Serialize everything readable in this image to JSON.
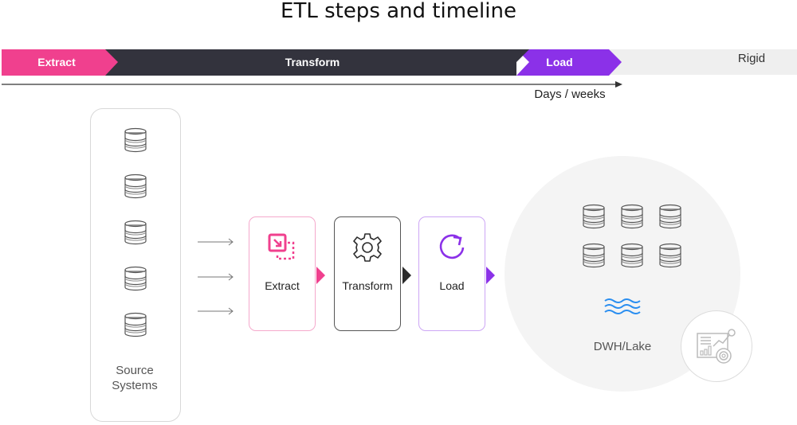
{
  "title": "ETL steps and timeline",
  "timeline": {
    "segments": [
      {
        "label": "Extract",
        "color": "#f0408e"
      },
      {
        "label": "Transform",
        "color": "#33333d"
      },
      {
        "label": "Load",
        "color": "#8b31e8"
      }
    ],
    "remainder_label": "Rigid",
    "remainder_color": "#efefef",
    "axis_label": "Days / weeks"
  },
  "source_systems": {
    "label_line1": "Source",
    "label_line2": "Systems",
    "database_count": 5,
    "icon": "database-icon"
  },
  "flow_arrows": 3,
  "steps": [
    {
      "label": "Extract",
      "icon": "extract-icon",
      "color": "#f0408e",
      "border": "#f5a9cc"
    },
    {
      "label": "Transform",
      "icon": "gear-icon",
      "color": "#2b2b2b",
      "border": "#555555"
    },
    {
      "label": "Load",
      "icon": "refresh-icon",
      "color": "#8b31e8",
      "border": "#cda6f5"
    }
  ],
  "destination": {
    "label": "DWH/Lake",
    "database_count": 6,
    "lake_icon": "water-waves-icon",
    "lake_color": "#2a8ef0",
    "analytics_icon": "analytics-dashboard-icon"
  }
}
